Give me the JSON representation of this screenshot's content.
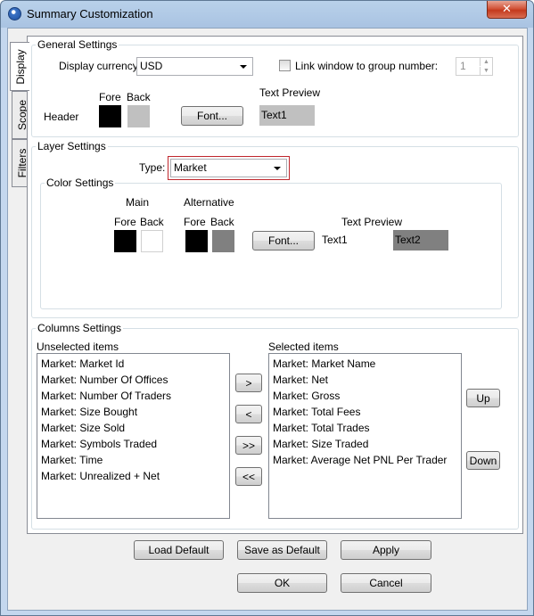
{
  "window": {
    "title": "Summary Customization",
    "close": "✕"
  },
  "tabs": [
    "Display",
    "Scope",
    "Filters"
  ],
  "general": {
    "legend": "General Settings",
    "currency_label": "Display currency:",
    "currency_value": "USD",
    "link_label": "Link window to group number:",
    "link_value": "1",
    "fore_label": "Fore",
    "back_label": "Back",
    "header_label": "Header",
    "font_button": "Font...",
    "text_preview_label": "Text Preview",
    "text_preview_value": "Text1",
    "fore_color": "#000000",
    "back_color": "#c0c0c0"
  },
  "layer": {
    "legend": "Layer Settings",
    "type_label": "Type:",
    "type_value": "Market",
    "color_legend": "Color Settings",
    "main_label": "Main",
    "alt_label": "Alternative",
    "fore_label": "Fore",
    "back_label": "Back",
    "font_button": "Font...",
    "text_preview_label": "Text Preview",
    "text1": "Text1",
    "text2": "Text2",
    "main_fore_color": "#000000",
    "main_back_color": "#ffffff",
    "alt_fore_color": "#000000",
    "alt_back_color": "#808080"
  },
  "columns": {
    "legend": "Columns Settings",
    "unselected_label": "Unselected items",
    "selected_label": "Selected items",
    "unselected": [
      "Market: Market Id",
      "Market: Number Of Offices",
      "Market: Number Of Traders",
      "Market: Size Bought",
      "Market: Size Sold",
      "Market: Symbols Traded",
      "Market: Time",
      "Market: Unrealized + Net"
    ],
    "selected": [
      "Market: Market Name",
      "Market: Net",
      "Market: Gross",
      "Market: Total Fees",
      "Market: Total Trades",
      "Market: Size Traded",
      "Market: Average Net PNL Per Trader"
    ],
    "add_button": ">",
    "remove_button": "<",
    "add_all_button": ">>",
    "remove_all_button": "<<",
    "up_button": "Up",
    "down_button": "Down"
  },
  "footer": {
    "load_default": "Load Default",
    "save_as_default": "Save as Default",
    "apply": "Apply",
    "ok": "OK",
    "cancel": "Cancel"
  }
}
